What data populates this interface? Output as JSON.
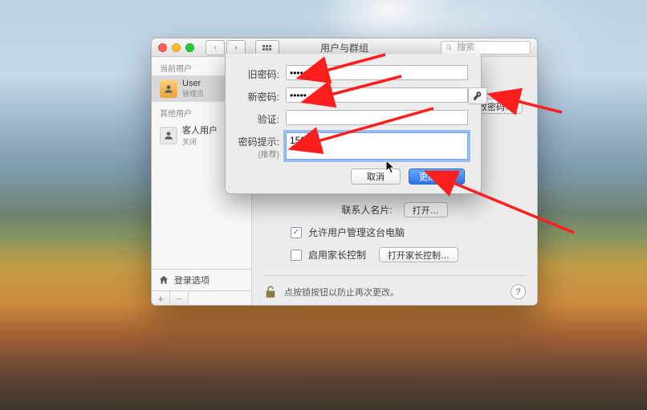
{
  "window": {
    "title": "用户与群组",
    "search_placeholder": "搜索"
  },
  "sidebar": {
    "sections": [
      {
        "label": "当前用户"
      },
      {
        "label": "其他用户"
      }
    ],
    "current_user": {
      "name": "User",
      "role": "管理员"
    },
    "guest_user": {
      "name": "客人用户",
      "status": "关闭"
    },
    "login_options_label": "登录选项",
    "plus": "+",
    "minus": "−"
  },
  "content": {
    "change_password_btn": "更改密码…",
    "contacts_label": "联系人名片:",
    "open_btn": "打开…",
    "allow_admin_label": "允许用户管理这台电脑",
    "allow_admin_checked": true,
    "parental_label": "启用家长控制",
    "parental_checked": false,
    "parental_btn": "打开家长控制…",
    "lock_text": "点按锁按钮以防止再次更改。"
  },
  "sheet": {
    "old_pw_label": "旧密码:",
    "new_pw_label": "新密码:",
    "verify_label": "验证:",
    "hint_label": "密码提示:",
    "hint_sublabel": "(推荐)",
    "old_pw_value": "•••••",
    "new_pw_value": "•••••",
    "verify_value": "",
    "hint_value": "159",
    "cancel_btn": "取消",
    "confirm_btn": "更改密码"
  }
}
